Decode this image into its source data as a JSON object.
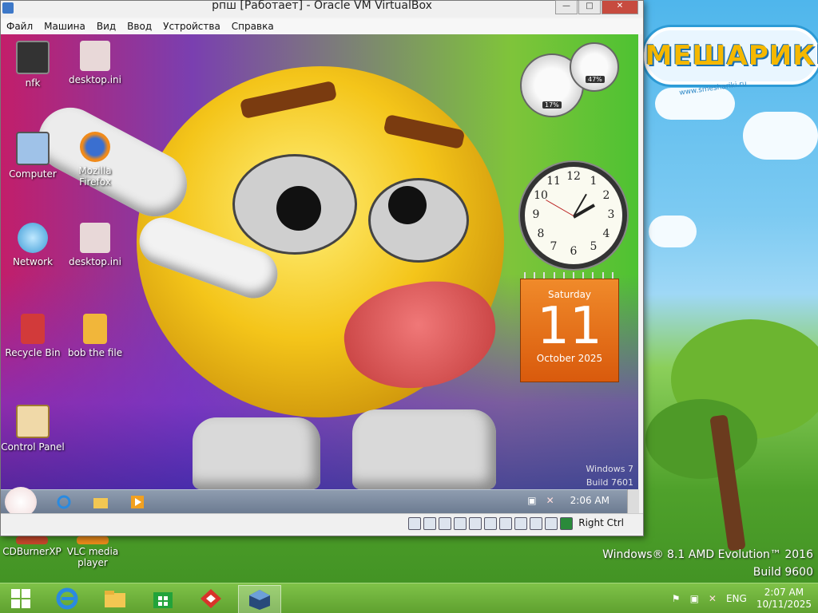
{
  "host": {
    "logo_text": "СМЕШАРИКИ",
    "logo_url": "www.smeshariki.ru",
    "watermark": [
      "Windows® 8.1 AMD Evolution™ 2016",
      "Build 9600"
    ],
    "icons": [
      {
        "label": "CDBurnerXP",
        "icon": "cdburner-icon"
      },
      {
        "label": "VLC media player",
        "icon": "vlc-icon"
      }
    ],
    "taskbar": {
      "apps": [
        "start-icon",
        "ie-icon",
        "explorer-icon",
        "store-icon",
        "security-icon",
        "virtualbox-icon"
      ],
      "tray": {
        "lang": "ENG",
        "time": "2:07 AM",
        "date": "10/11/2025"
      }
    }
  },
  "vbox": {
    "title": "рпш [Работает] - Oracle VM VirtualBox",
    "menu": [
      "Файл",
      "Машина",
      "Вид",
      "Ввод",
      "Устройства",
      "Справка"
    ],
    "status_key": "Right Ctrl"
  },
  "guest": {
    "icons": [
      {
        "label": "nfk",
        "icon": "nfk-icon"
      },
      {
        "label": "desktop.ini",
        "icon": "ini-file-icon"
      },
      {
        "label": "Computer",
        "icon": "computer-icon"
      },
      {
        "label": "Mozilla Firefox",
        "icon": "firefox-icon"
      },
      {
        "label": "Network",
        "icon": "network-icon"
      },
      {
        "label": "desktop.ini",
        "icon": "ini-file-icon"
      },
      {
        "label": "Recycle Bin",
        "icon": "recycle-bin-icon"
      },
      {
        "label": "bob the file",
        "icon": "folder-icon"
      },
      {
        "label": "Control Panel",
        "icon": "control-panel-icon"
      }
    ],
    "meters": {
      "cpu": "17%",
      "mem": "47%"
    },
    "calendar": {
      "weekday": "Saturday",
      "day": "11",
      "month_year": "October 2025"
    },
    "clock_numbers": [
      "12",
      "1",
      "2",
      "3",
      "4",
      "5",
      "6",
      "7",
      "8",
      "9",
      "10",
      "11"
    ],
    "watermark": [
      "Windows 7",
      "Build 7601"
    ],
    "taskbar_time": "2:06 AM"
  }
}
